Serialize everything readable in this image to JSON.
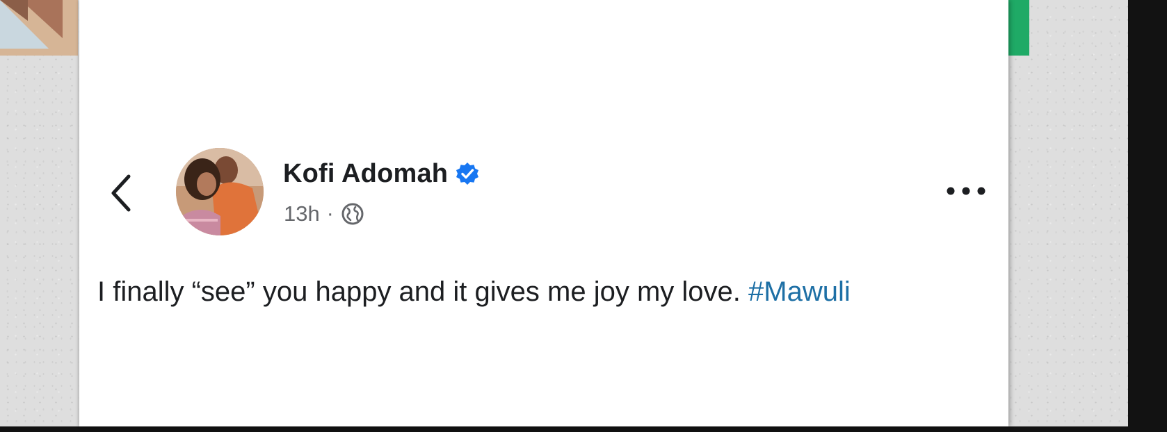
{
  "post": {
    "author": "Kofi Adomah",
    "verified_icon": "verified-badge-icon",
    "timestamp": "13h",
    "separator": "·",
    "audience_icon": "globe-icon",
    "text": "I finally “see” you happy and it gives me joy my love.",
    "hashtag": "#Mawuli"
  },
  "icons": {
    "back": "chevron-left-icon",
    "more": "more-horizontal-icon"
  },
  "colors": {
    "verified": "#1877f2",
    "hashtag": "#1d6fa5",
    "text": "#1c1e21",
    "meta": "#65676b"
  }
}
